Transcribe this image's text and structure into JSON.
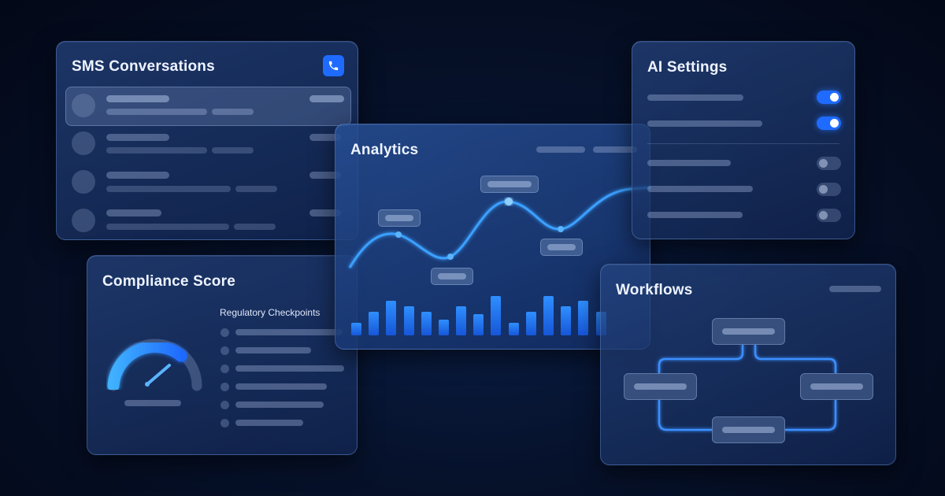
{
  "sms": {
    "title": "SMS Conversations",
    "call_icon": "phone-icon",
    "rows": 4
  },
  "analytics": {
    "title": "Analytics",
    "accent": "#2f8fff",
    "line_points": 8,
    "bar_count": 16
  },
  "ai_settings": {
    "title": "AI Settings",
    "toggles": [
      {
        "state": "on"
      },
      {
        "state": "on"
      },
      {
        "state": "off"
      },
      {
        "state": "off"
      },
      {
        "state": "off"
      }
    ]
  },
  "compliance": {
    "title": "Compliance Score",
    "checkpoints_label": "Regulatory Checkpoints",
    "gauge_icon": "gauge-icon"
  },
  "workflows": {
    "title": "Workflows",
    "node_count": 4
  },
  "colors": {
    "accent": "#1f6bff",
    "glow": "#3aa0ff",
    "panel": "#1a3366"
  }
}
